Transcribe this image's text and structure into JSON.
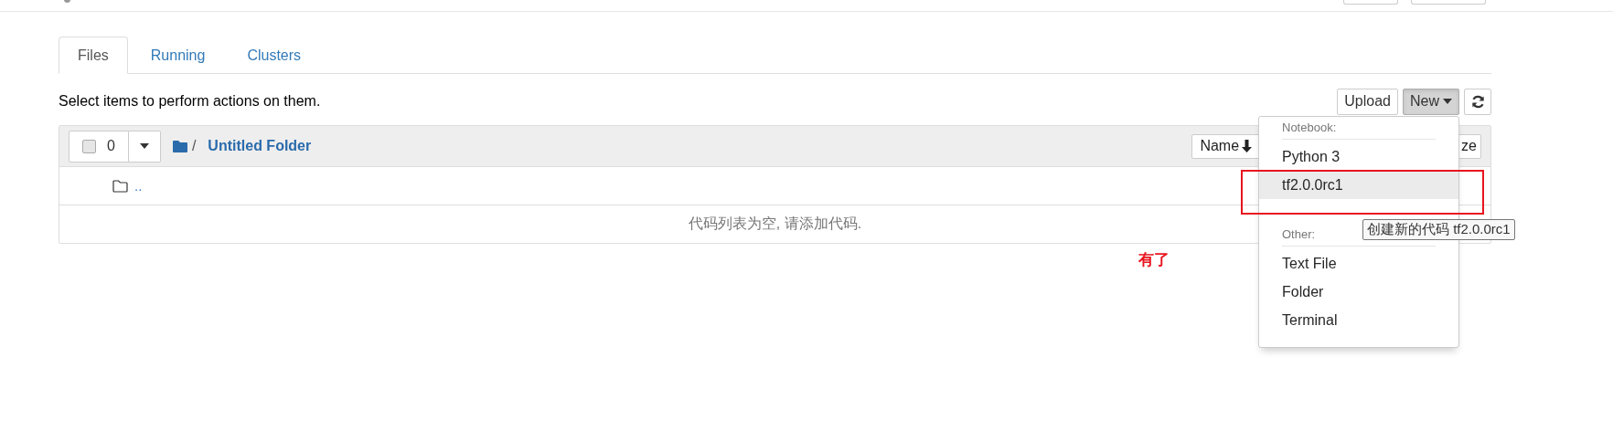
{
  "tabs": [
    {
      "label": "Files",
      "selected": true
    },
    {
      "label": "Running",
      "selected": false
    },
    {
      "label": "Clusters",
      "selected": false
    }
  ],
  "toolbar": {
    "hint": "Select items to perform actions on them.",
    "buttons": [
      {
        "kind": "text",
        "label": "Upload",
        "selected": false
      },
      {
        "kind": "dropdown",
        "label": "New",
        "selected": true
      },
      {
        "kind": "refresh",
        "selected": false
      }
    ]
  },
  "file_list": {
    "select_count": "0",
    "checked": false,
    "path_separator": "/",
    "path": "Untitled Folder",
    "sort_buttons": [
      "Name",
      "ze"
    ],
    "rows": [
      {
        "kind": "folder",
        "name": ".."
      }
    ],
    "empty_message": "代码列表为空, 请添加代码."
  },
  "new_menu": {
    "sections": [
      {
        "header": "Notebook:",
        "items": [
          {
            "label": "Python 3",
            "selected": false
          },
          {
            "label": "tf2.0.0rc1",
            "selected": true
          }
        ]
      },
      {
        "header": "Other:",
        "items": [
          {
            "label": "Text File",
            "selected": false
          },
          {
            "label": "Folder",
            "selected": false
          },
          {
            "label": "Terminal",
            "selected": false
          }
        ]
      }
    ]
  },
  "tooltip": "创建新的代码 tf2.0.0rc1",
  "annotation": "有了"
}
